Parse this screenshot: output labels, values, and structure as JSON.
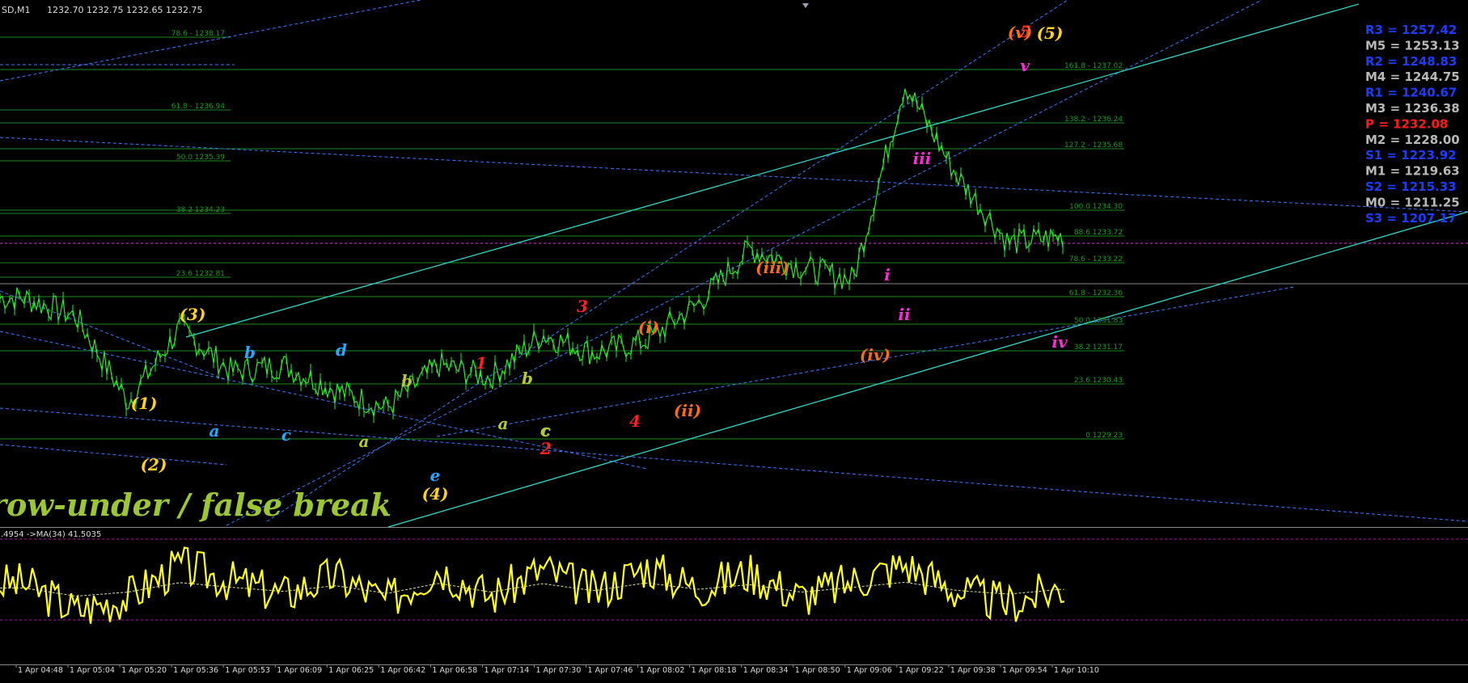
{
  "header": {
    "symbol": "SD,M1",
    "ohlc": "1232.70 1232.75 1232.65 1232.75"
  },
  "pivots": [
    {
      "label": "R3 = 1257.42",
      "color": "#1c3cff"
    },
    {
      "label": "M5 = 1253.13",
      "color": "#b8b8b8"
    },
    {
      "label": "R2 = 1248.83",
      "color": "#1c3cff"
    },
    {
      "label": "M4 = 1244.75",
      "color": "#b8b8b8"
    },
    {
      "label": "R1 = 1240.67",
      "color": "#1c3cff"
    },
    {
      "label": "M3 = 1236.38",
      "color": "#b8b8b8"
    },
    {
      "label": "P   = 1232.08",
      "color": "#ff1a1a"
    },
    {
      "label": "M2 = 1228.00",
      "color": "#b8b8b8"
    },
    {
      "label": "S1 = 1223.92",
      "color": "#1c3cff"
    },
    {
      "label": "M1 = 1219.63",
      "color": "#b8b8b8"
    },
    {
      "label": "S2 = 1215.33",
      "color": "#1c3cff"
    },
    {
      "label": "M0 = 1211.25",
      "color": "#b8b8b8"
    },
    {
      "label": "S3 = 1207.17",
      "color": "#1c3cff"
    }
  ],
  "fib_left": [
    "78.6 - 1238.17",
    "61.8 - 1236.94",
    "50.0 1235.39",
    "38.2 1234.23",
    "23.6 1232.81"
  ],
  "fib_right": [
    "161.8 - 1237.02",
    "138.2 - 1236.24",
    "127.2 - 1235.68",
    "100.0 1234.30",
    "88.6 1233.72",
    "78.6 - 1233.22",
    "61.8 - 1232.36",
    "50.0 1231.83",
    "38.2 1231.17",
    "23.6 1230.43",
    "0 1229.23"
  ],
  "annotation": "row-under / false break",
  "indicator": {
    "label": ".4954  ->MA(34) 41.5035"
  },
  "wave_labels": [
    {
      "text": "(1)",
      "color": "#ffd21f"
    },
    {
      "text": "(2)",
      "color": "#ffd21f"
    },
    {
      "text": "(3)",
      "color": "#ffd21f"
    },
    {
      "text": "(4)",
      "color": "#ffd21f"
    },
    {
      "text": "(5)",
      "color": "#ffd21f"
    },
    {
      "text": "a",
      "color": "#2aa7ff"
    },
    {
      "text": "b",
      "color": "#2aa7ff"
    },
    {
      "text": "c",
      "color": "#2aa7ff"
    },
    {
      "text": "d",
      "color": "#2aa7ff"
    },
    {
      "text": "e",
      "color": "#2aa7ff"
    },
    {
      "text": "a",
      "color": "#b5c934"
    },
    {
      "text": "b",
      "color": "#b5c934"
    },
    {
      "text": "c",
      "color": "#b5c934"
    },
    {
      "text": "a",
      "color": "#b5c934"
    },
    {
      "text": "b",
      "color": "#b5c934"
    },
    {
      "text": "c",
      "color": "#b5c934"
    },
    {
      "text": "1",
      "color": "#ff2020"
    },
    {
      "text": "2",
      "color": "#ff2020"
    },
    {
      "text": "3",
      "color": "#ff2020"
    },
    {
      "text": "4",
      "color": "#ff2020"
    },
    {
      "text": "5",
      "color": "#ff2020"
    },
    {
      "text": "(i)",
      "color": "#ff6a1a"
    },
    {
      "text": "(ii)",
      "color": "#ff6a1a"
    },
    {
      "text": "(iii)",
      "color": "#ff6a1a"
    },
    {
      "text": "(iv)",
      "color": "#ff6a1a"
    },
    {
      "text": "(v)",
      "color": "#ff6a1a"
    },
    {
      "text": "i",
      "color": "#ff2bd6"
    },
    {
      "text": "ii",
      "color": "#ff2bd6"
    },
    {
      "text": "iii",
      "color": "#ff2bd6"
    },
    {
      "text": "iv",
      "color": "#ff2bd6"
    },
    {
      "text": "v",
      "color": "#ff2bd6"
    }
  ],
  "chart_data": {
    "type": "line",
    "title": "",
    "x": [
      "1 Apr 04:48",
      "1 Apr 05:04",
      "1 Apr 05:20",
      "1 Apr 05:36",
      "1 Apr 05:53",
      "1 Apr 06:09",
      "1 Apr 06:25",
      "1 Apr 06:42",
      "1 Apr 06:58",
      "1 Apr 07:14",
      "1 Apr 07:30",
      "1 Apr 07:46",
      "1 Apr 08:02",
      "1 Apr 08:18",
      "1 Apr 08:34",
      "1 Apr 08:50",
      "1 Apr 09:06",
      "1 Apr 09:22",
      "1 Apr 09:38",
      "1 Apr 09:54",
      "1 Apr 10:10"
    ],
    "series": [
      {
        "values": [
          1231.6,
          1231.3,
          1229.9,
          1231.1,
          1230.4,
          1230.5,
          1230.1,
          1229.8,
          1230.5,
          1230.3,
          1231.0,
          1230.7,
          1230.9,
          1231.5,
          1232.4,
          1232.1,
          1231.9,
          1235.1,
          1233.6,
          1232.5,
          1232.6
        ]
      },
      {
        "values": [
          56,
          32,
          44,
          72,
          58,
          46,
          63,
          40,
          70,
          44,
          69,
          48,
          71,
          52,
          66,
          44,
          58,
          73,
          49,
          38,
          52
        ]
      }
    ],
    "colors": {
      "price": "#2ee62e",
      "oscillator": "#ffff1a",
      "ma": "#e0e0a0",
      "channel": "#2fd8c8",
      "trend": "#3a7bff",
      "fib": "#1e8a1e"
    }
  }
}
